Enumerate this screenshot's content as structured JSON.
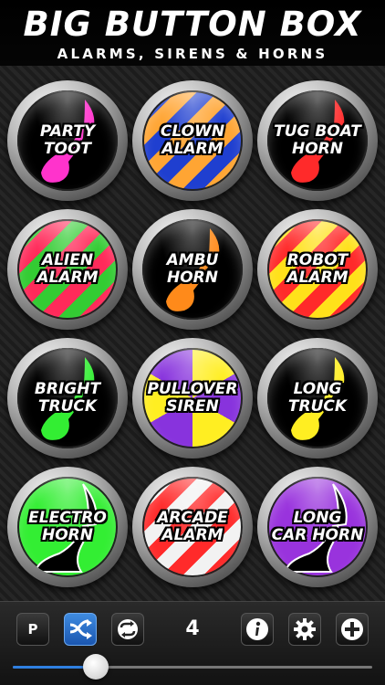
{
  "header": {
    "title": "BIG BUTTON BOX",
    "subtitle": "ALARMS, SIRENS & HORNS"
  },
  "buttons": [
    {
      "line1": "PARTY",
      "line2": "TOOT",
      "style": "horn",
      "bg": "#000000",
      "accent": "#ff33cc"
    },
    {
      "line1": "CLOWN",
      "line2": "ALARM",
      "style": "stripes",
      "bg": "#1f3fd0",
      "accent": "#ffa533"
    },
    {
      "line1": "TUG BOAT",
      "line2": "HORN",
      "style": "horn",
      "bg": "#000000",
      "accent": "#ff2a2a"
    },
    {
      "line1": "ALIEN",
      "line2": "ALARM",
      "style": "stripes",
      "bg": "#33cc33",
      "accent": "#ff2a5a"
    },
    {
      "line1": "AMBU",
      "line2": "HORN",
      "style": "horn",
      "bg": "#000000",
      "accent": "#ff8a1a"
    },
    {
      "line1": "ROBOT",
      "line2": "ALARM",
      "style": "stripes",
      "bg": "#ffe11a",
      "accent": "#ff2a2a"
    },
    {
      "line1": "BRIGHT",
      "line2": "TRUCK",
      "style": "horn",
      "bg": "#000000",
      "accent": "#33ee33"
    },
    {
      "line1": "PULLOVER",
      "line2": "SIREN",
      "style": "radial",
      "bg": "#8833dd",
      "accent": "#ffee22"
    },
    {
      "line1": "LONG",
      "line2": "TRUCK",
      "style": "horn",
      "bg": "#000000",
      "accent": "#ffee22"
    },
    {
      "line1": "ELECTRO",
      "line2": "HORN",
      "style": "hornbig",
      "bg": "#33ee33",
      "accent": "#000000"
    },
    {
      "line1": "ARCADE",
      "line2": "ALARM",
      "style": "stripes",
      "bg": "#f2f2f2",
      "accent": "#ff2a2a"
    },
    {
      "line1": "LONG",
      "line2": "CAR HORN",
      "style": "hornbig",
      "bg": "#9933dd",
      "accent": "#000000"
    }
  ],
  "toolbar": {
    "p_label": "P",
    "count": "4",
    "icons": [
      "p-button",
      "shuffle-icon",
      "repeat-icon",
      "info-icon",
      "gear-icon",
      "plus-icon"
    ]
  },
  "volume": 0.23
}
